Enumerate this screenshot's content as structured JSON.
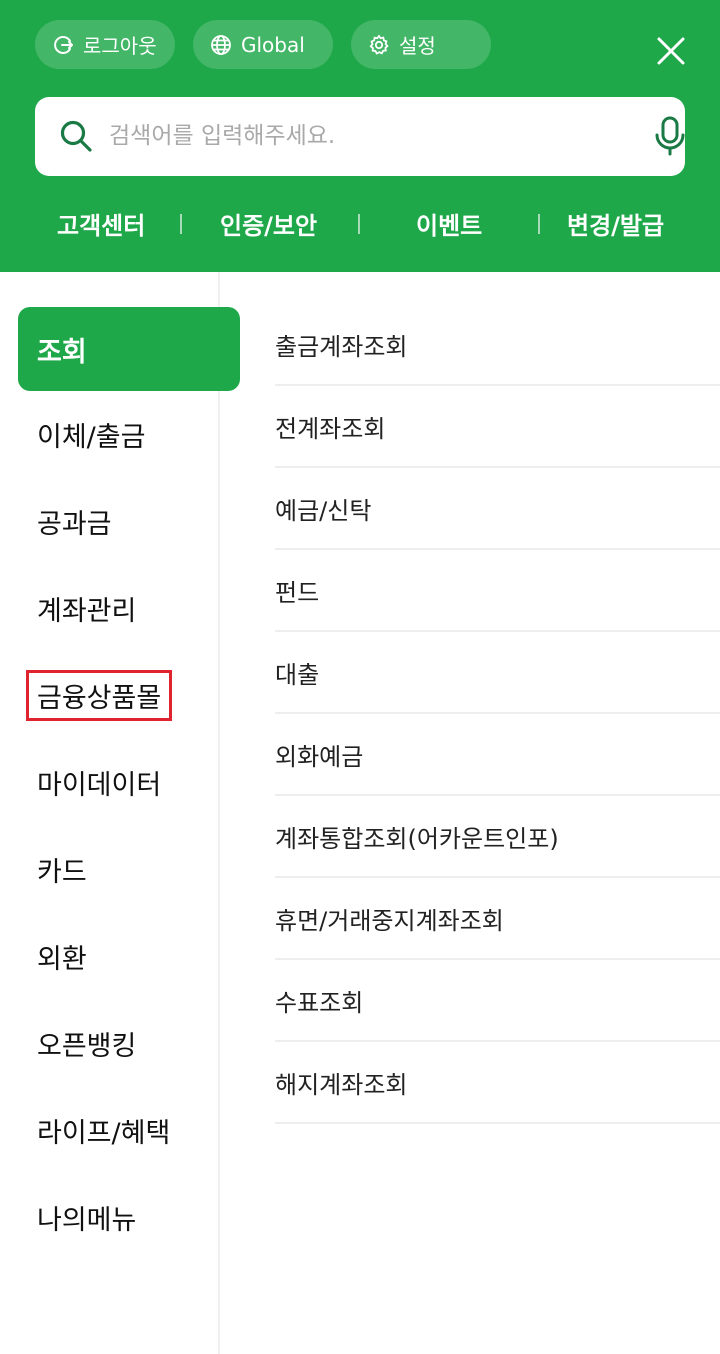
{
  "header": {
    "background_color": "#1fa84a",
    "pills": [
      {
        "label": "로그아웃",
        "icon": "logout-icon"
      },
      {
        "label": "Global",
        "icon": "globe-icon"
      },
      {
        "label": "설정",
        "icon": "gear-icon"
      }
    ],
    "close_icon": "close-icon"
  },
  "search": {
    "placeholder": "검색어를 입력해주세요.",
    "value": "",
    "icons": [
      "search-icon",
      "microphone-icon"
    ]
  },
  "quick_links": [
    "고객센터",
    "인증/보안",
    "이벤트",
    "변경/발급"
  ],
  "left_nav": {
    "active_index": 0,
    "highlighted_index": 4,
    "items": [
      "조회",
      "이체/출금",
      "공과금",
      "계좌관리",
      "금융상품몰",
      "마이데이터",
      "카드",
      "외환",
      "오픈뱅킹",
      "라이프/혜택",
      "나의메뉴"
    ]
  },
  "sub_menu": {
    "items": [
      "출금계좌조회",
      "전계좌조회",
      "예금/신탁",
      "펀드",
      "대출",
      "외화예금",
      "계좌통합조회(어카운트인포)",
      "휴면/거래중지계좌조회",
      "수표조회",
      "해지계좌조회"
    ]
  },
  "colors": {
    "accent": "#1fa84a",
    "highlight_border": "#e0242f"
  }
}
